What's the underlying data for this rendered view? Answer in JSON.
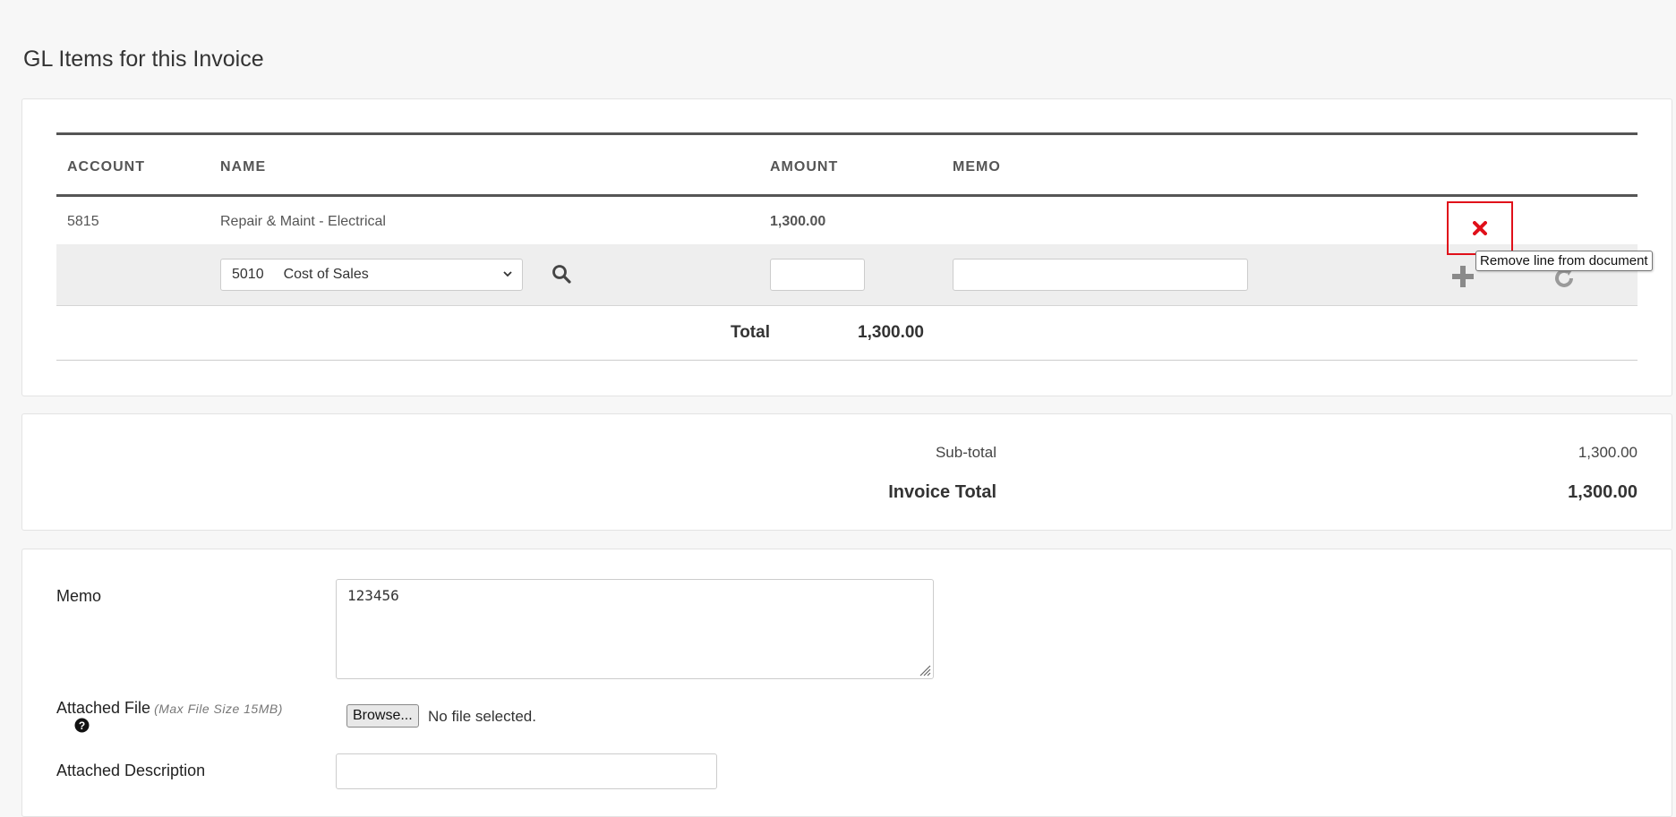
{
  "section_title": "GL Items for this Invoice",
  "table": {
    "headers": {
      "account": "ACCOUNT",
      "name": "NAME",
      "amount": "AMOUNT",
      "memo": "MEMO"
    },
    "rows": [
      {
        "account": "5815",
        "name": "Repair & Maint - Electrical",
        "amount": "1,300.00",
        "memo": ""
      }
    ],
    "new_line": {
      "account_select": {
        "number": "5010",
        "name": "Cost of Sales"
      },
      "amount_value": "",
      "memo_value": ""
    },
    "total_label": "Total",
    "total_value": "1,300.00"
  },
  "remove_tooltip": "Remove line from document",
  "totals": {
    "subtotal_label": "Sub-total",
    "subtotal_value": "1,300.00",
    "invoice_total_label": "Invoice Total",
    "invoice_total_value": "1,300.00"
  },
  "details": {
    "memo_label": "Memo",
    "memo_value": "123456",
    "attached_file_label": "Attached File",
    "max_file_size": "(Max File Size 15MB)",
    "browse_label": "Browse...",
    "no_file_text": "No file selected.",
    "attached_description_label": "Attached Description",
    "attached_description_value": ""
  },
  "colors": {
    "remove_red": "#e0101a",
    "header_rule": "#555555",
    "row_band": "#eeeeee"
  },
  "icons": [
    "search-icon",
    "plus-icon",
    "refresh-icon",
    "close-icon",
    "chevron-down-icon",
    "question-circle-icon",
    "resize-grip-icon"
  ]
}
